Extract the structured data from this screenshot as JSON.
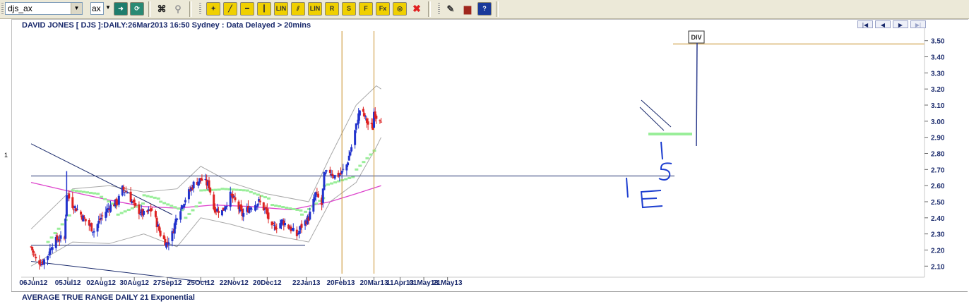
{
  "toolbar": {
    "symbol_value": "djs_ax",
    "exchange_value": "ax",
    "icons": [
      "go-arrow-icon",
      "refresh-icon",
      "binoculars-icon",
      "find-icon",
      "pointer-tool-icon",
      "trendline-icon",
      "horizontal-line-icon",
      "vertical-line-icon",
      "lin-icon",
      "parallel-lines-icon",
      "lin-channel-icon",
      "resistance-icon",
      "support-icon",
      "fibonacci-icon",
      "fibonacci-extension-icon",
      "cycle-icon",
      "delete-drawings-icon",
      "alert-icon",
      "book-icon",
      "help-icon"
    ],
    "btn_labels": {
      "lin": "LIN",
      "lin2": "LIN",
      "r": "R",
      "s": "S",
      "f": "F",
      "fx": "Fx",
      "help": "?"
    }
  },
  "header": {
    "title": "DAVID JONES [ DJS ]:DAILY:26Mar2013 16:50 Sydney : Data Delayed > 20mins",
    "nav": [
      "|◀",
      "◀",
      "▶",
      "▶|"
    ]
  },
  "side_label": "1",
  "bottom_panel": {
    "title": "AVERAGE TRUE RANGE DAILY 21 Exponential"
  },
  "annotation": {
    "div_label": "DIV"
  },
  "colors": {
    "up": "#2233cc",
    "down": "#dd2222",
    "ma": "#dd44cc",
    "sar": "#99ee99",
    "band": "#a8a8a8",
    "trend": "#1a2a6c",
    "vline": "#c8902a",
    "ink": "#1e3fd0"
  },
  "chart_data": {
    "type": "candlestick",
    "title": "DAVID JONES [ DJS ]:DAILY:26Mar2013 16:50 Sydney : Data Delayed > 20mins",
    "x_tick_labels": [
      "06Jun12",
      "05Jul12",
      "02Aug12",
      "30Aug12",
      "27Sep12",
      "25Oct12",
      "22Nov12",
      "20Dec12",
      "22Jan13",
      "20Feb13",
      "20Mar13",
      "11Apr13",
      "01May13",
      "21May13"
    ],
    "y_tick_labels": [
      "3.50",
      "3.40",
      "3.30",
      "3.20",
      "3.10",
      "3.00",
      "2.90",
      "2.80",
      "2.70",
      "2.60",
      "2.50",
      "2.40",
      "2.30",
      "2.20",
      "2.10"
    ],
    "ylim": [
      2.04,
      3.56
    ],
    "bars_start_date": "2012-06-04",
    "close_points": [
      [
        "2012-06-04",
        2.22
      ],
      [
        "2012-06-08",
        2.14
      ],
      [
        "2012-06-13",
        2.12
      ],
      [
        "2012-06-18",
        2.17
      ],
      [
        "2012-06-22",
        2.24
      ],
      [
        "2012-06-27",
        2.27
      ],
      [
        "2012-07-02",
        2.27
      ],
      [
        "2012-07-04",
        2.55
      ],
      [
        "2012-07-09",
        2.48
      ],
      [
        "2012-07-13",
        2.45
      ],
      [
        "2012-07-20",
        2.38
      ],
      [
        "2012-07-27",
        2.32
      ],
      [
        "2012-08-02",
        2.4
      ],
      [
        "2012-08-09",
        2.47
      ],
      [
        "2012-08-16",
        2.5
      ],
      [
        "2012-08-20",
        2.58
      ],
      [
        "2012-08-24",
        2.56
      ],
      [
        "2012-08-31",
        2.46
      ],
      [
        "2012-09-07",
        2.42
      ],
      [
        "2012-09-14",
        2.45
      ],
      [
        "2012-09-21",
        2.3
      ],
      [
        "2012-09-26",
        2.24
      ],
      [
        "2012-10-01",
        2.3
      ],
      [
        "2012-10-05",
        2.42
      ],
      [
        "2012-10-12",
        2.52
      ],
      [
        "2012-10-19",
        2.61
      ],
      [
        "2012-10-25",
        2.64
      ],
      [
        "2012-11-01",
        2.6
      ],
      [
        "2012-11-05",
        2.46
      ],
      [
        "2012-11-12",
        2.44
      ],
      [
        "2012-11-19",
        2.54
      ],
      [
        "2012-11-23",
        2.5
      ],
      [
        "2012-11-29",
        2.42
      ],
      [
        "2012-12-06",
        2.47
      ],
      [
        "2012-12-13",
        2.5
      ],
      [
        "2012-12-19",
        2.44
      ],
      [
        "2012-12-24",
        2.33
      ],
      [
        "2013-01-02",
        2.38
      ],
      [
        "2013-01-09",
        2.33
      ],
      [
        "2013-01-14",
        2.29
      ],
      [
        "2013-01-18",
        2.35
      ],
      [
        "2013-01-24",
        2.4
      ],
      [
        "2013-01-30",
        2.55
      ],
      [
        "2013-02-04",
        2.48
      ],
      [
        "2013-02-06",
        2.66
      ],
      [
        "2013-02-11",
        2.69
      ],
      [
        "2013-02-15",
        2.66
      ],
      [
        "2013-02-20",
        2.67
      ],
      [
        "2013-02-25",
        2.73
      ],
      [
        "2013-03-01",
        2.84
      ],
      [
        "2013-03-05",
        2.97
      ],
      [
        "2013-03-08",
        3.07
      ],
      [
        "2013-03-12",
        3.03
      ],
      [
        "2013-03-15",
        2.98
      ],
      [
        "2013-03-19",
        2.96
      ],
      [
        "2013-03-20",
        3.06
      ],
      [
        "2013-03-22",
        3.03
      ],
      [
        "2013-03-26",
        3.02
      ]
    ],
    "upper_band": [
      [
        "2012-06-04",
        2.33
      ],
      [
        "2012-07-09",
        2.58
      ],
      [
        "2012-08-09",
        2.6
      ],
      [
        "2012-09-07",
        2.56
      ],
      [
        "2012-10-05",
        2.58
      ],
      [
        "2012-10-25",
        2.72
      ],
      [
        "2012-11-19",
        2.62
      ],
      [
        "2012-12-19",
        2.55
      ],
      [
        "2013-01-24",
        2.5
      ],
      [
        "2013-02-11",
        2.78
      ],
      [
        "2013-03-05",
        3.1
      ],
      [
        "2013-03-22",
        3.22
      ],
      [
        "2013-03-26",
        3.2
      ]
    ],
    "lower_band": [
      [
        "2012-06-04",
        2.1
      ],
      [
        "2012-07-09",
        2.25
      ],
      [
        "2012-08-09",
        2.24
      ],
      [
        "2012-09-07",
        2.3
      ],
      [
        "2012-10-05",
        2.22
      ],
      [
        "2012-10-25",
        2.4
      ],
      [
        "2012-11-19",
        2.36
      ],
      [
        "2012-12-19",
        2.3
      ],
      [
        "2013-01-24",
        2.25
      ],
      [
        "2013-02-11",
        2.5
      ],
      [
        "2013-03-05",
        2.62
      ],
      [
        "2013-03-22",
        2.84
      ],
      [
        "2013-03-26",
        2.9
      ]
    ],
    "moving_average": [
      [
        "2012-06-04",
        2.62
      ],
      [
        "2012-07-09",
        2.56
      ],
      [
        "2012-08-09",
        2.51
      ],
      [
        "2012-09-07",
        2.47
      ],
      [
        "2012-10-05",
        2.46
      ],
      [
        "2012-11-05",
        2.48
      ],
      [
        "2012-12-06",
        2.47
      ],
      [
        "2013-01-09",
        2.45
      ],
      [
        "2013-02-11",
        2.5
      ],
      [
        "2013-03-05",
        2.55
      ],
      [
        "2013-03-26",
        2.6
      ]
    ],
    "sar_points": [
      [
        "2012-06-18",
        2.25
      ],
      [
        "2012-07-09",
        2.57
      ],
      [
        "2012-08-02",
        2.53
      ],
      [
        "2012-08-16",
        2.42
      ],
      [
        "2012-09-07",
        2.54
      ],
      [
        "2012-09-21",
        2.5
      ],
      [
        "2012-10-12",
        2.4
      ],
      [
        "2012-10-25",
        2.57
      ],
      [
        "2012-11-12",
        2.58
      ],
      [
        "2012-12-06",
        2.56
      ],
      [
        "2012-12-24",
        2.48
      ],
      [
        "2013-01-18",
        2.42
      ],
      [
        "2013-02-06",
        2.6
      ],
      [
        "2013-03-05",
        2.7
      ],
      [
        "2013-03-22",
        2.92
      ]
    ],
    "horizontal_lines": [
      2.66,
      2.23
    ],
    "trend_lines": [
      {
        "from": [
          "2012-06-04",
          2.86
        ],
        "to": [
          "2012-10-01",
          2.42
        ]
      },
      {
        "from": [
          "2012-06-04",
          2.13
        ],
        "to": [
          "2012-10-31",
          2.0
        ]
      }
    ],
    "vertical_markers": [
      "2013-02-21",
      "2013-03-20"
    ],
    "div_level": 3.48,
    "grid": false,
    "y_axis_position": "right"
  }
}
